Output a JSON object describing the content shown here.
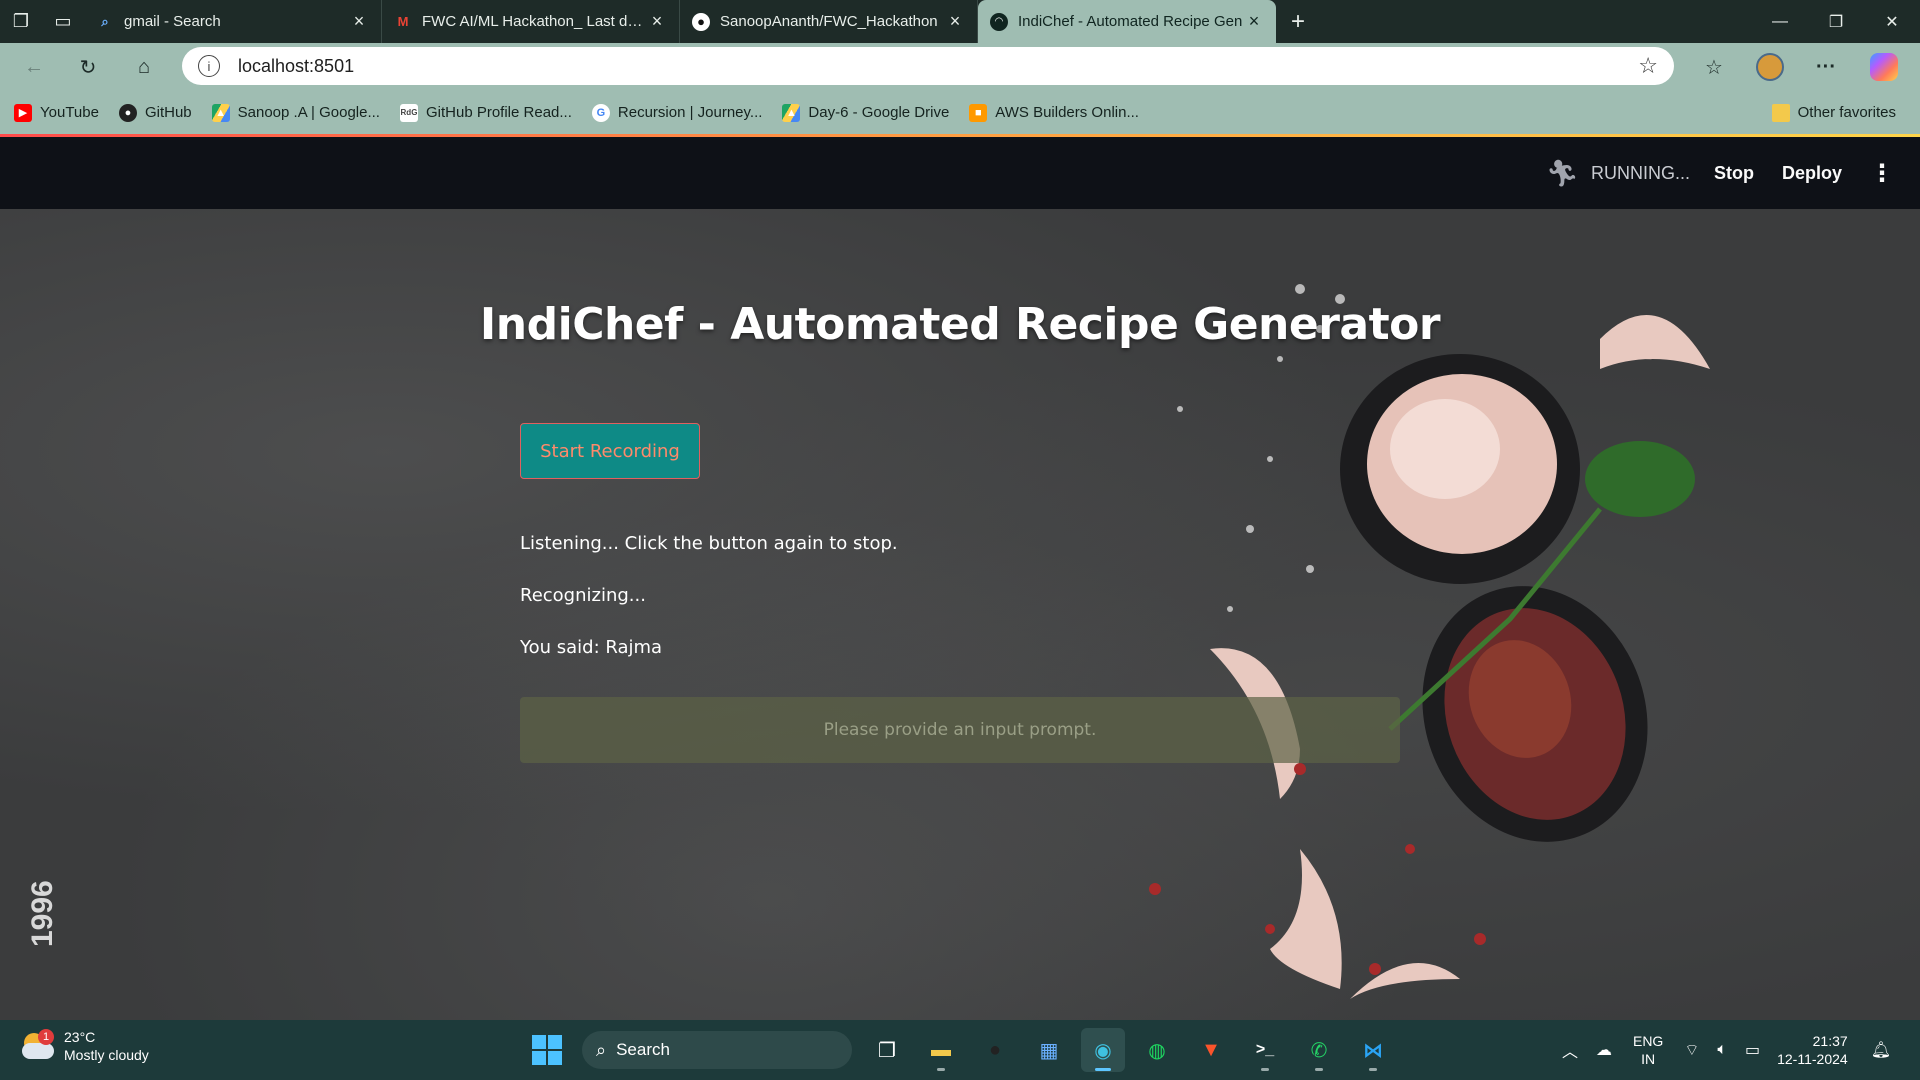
{
  "browser": {
    "tabs": [
      {
        "title": "gmail - Search",
        "icon": "search-icon"
      },
      {
        "title": "FWC AI/ML Hackathon_ Last date",
        "icon": "gmail-icon"
      },
      {
        "title": "SanoopAnanth/FWC_Hackathon",
        "icon": "github-icon"
      },
      {
        "title": "IndiChef - Automated Recipe Gen",
        "icon": "streamlit-icon",
        "active": true
      }
    ],
    "address": "localhost:8501",
    "bookmarks": [
      {
        "label": "YouTube",
        "icon": "youtube-icon",
        "color": "#ff0000"
      },
      {
        "label": "GitHub",
        "icon": "github-icon",
        "color": "#222222"
      },
      {
        "label": "Sanoop .A | Google...",
        "icon": "google-drive-icon",
        "color": "#1fa463"
      },
      {
        "label": "GitHub Profile Read...",
        "icon": "readme-icon",
        "color": "#444444"
      },
      {
        "label": "Recursion | Journey...",
        "icon": "google-icon",
        "color": "#4285f4"
      },
      {
        "label": "Day-6 - Google Drive",
        "icon": "google-drive-icon",
        "color": "#1fa463"
      },
      {
        "label": "AWS Builders Onlin...",
        "icon": "aws-icon",
        "color": "#ff9900"
      }
    ],
    "other_favorites": "Other favorites"
  },
  "header": {
    "status": "RUNNING...",
    "stop": "Stop",
    "deploy": "Deploy"
  },
  "app": {
    "title": "IndiChef - Automated Recipe Generator",
    "record_button": "Start Recording",
    "messages": [
      "Listening... Click the button again to stop.",
      "Recognizing...",
      "You said: Rajma"
    ],
    "prompt_placeholder": "Please provide an input prompt.",
    "watermark": "1996"
  },
  "taskbar": {
    "weather_temp": "23°C",
    "weather_desc": "Mostly cloudy",
    "weather_badge": "1",
    "search": "Search",
    "lang_top": "ENG",
    "lang_bottom": "IN",
    "time": "21:37",
    "date": "12-11-2024"
  },
  "colors": {
    "tab_strip": "#1e2b28",
    "chrome": "#9fbdb2",
    "streamlit_header": "#0e1117",
    "record_button_bg": "#0e8a86",
    "record_button_text": "#ff8a6b",
    "taskbar": "#1d3a3a"
  }
}
